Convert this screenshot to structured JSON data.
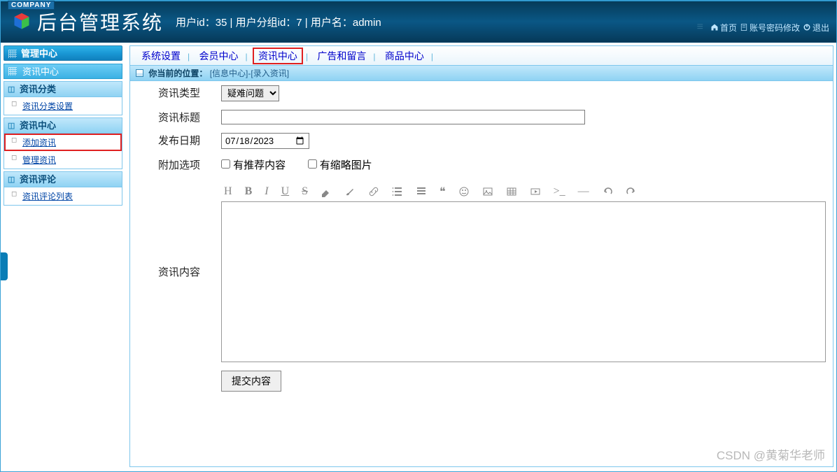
{
  "company_tag": "COMPANY",
  "header": {
    "title": "后台管理系统",
    "user_line": "用户id：35 | 用户分组id：7 | 用户名：admin",
    "links": {
      "home": "首页",
      "pwd": "账号密码修改",
      "exit": "退出"
    }
  },
  "sidebar": {
    "main_head": "管理中心",
    "bc_head": "资讯中心",
    "groups": [
      {
        "title": "资讯分类",
        "items": [
          "资讯分类设置"
        ],
        "hl": []
      },
      {
        "title": "资讯中心",
        "items": [
          "添加资讯",
          "管理资讯"
        ],
        "hl": [
          0
        ]
      },
      {
        "title": "资讯评论",
        "items": [
          "资讯评论列表"
        ],
        "hl": []
      }
    ]
  },
  "topnav": {
    "items": [
      "系统设置",
      "会员中心",
      "资讯中心",
      "广告和留言",
      "商品中心"
    ],
    "highlighted": 2
  },
  "breadcrumb": {
    "label": "你当前的位置：",
    "path": "[信息中心]-[录入资讯]"
  },
  "form": {
    "type_label": "资讯类型",
    "type_value": "疑难问题",
    "title_label": "资讯标题",
    "title_value": "",
    "date_label": "发布日期",
    "date_value": "2023/07/18",
    "options_label": "附加选项",
    "opt1": "有推荐内容",
    "opt2": "有缩略图片",
    "content_label": "资讯内容",
    "submit": "提交内容"
  },
  "watermark": "CSDN @黄菊华老师"
}
